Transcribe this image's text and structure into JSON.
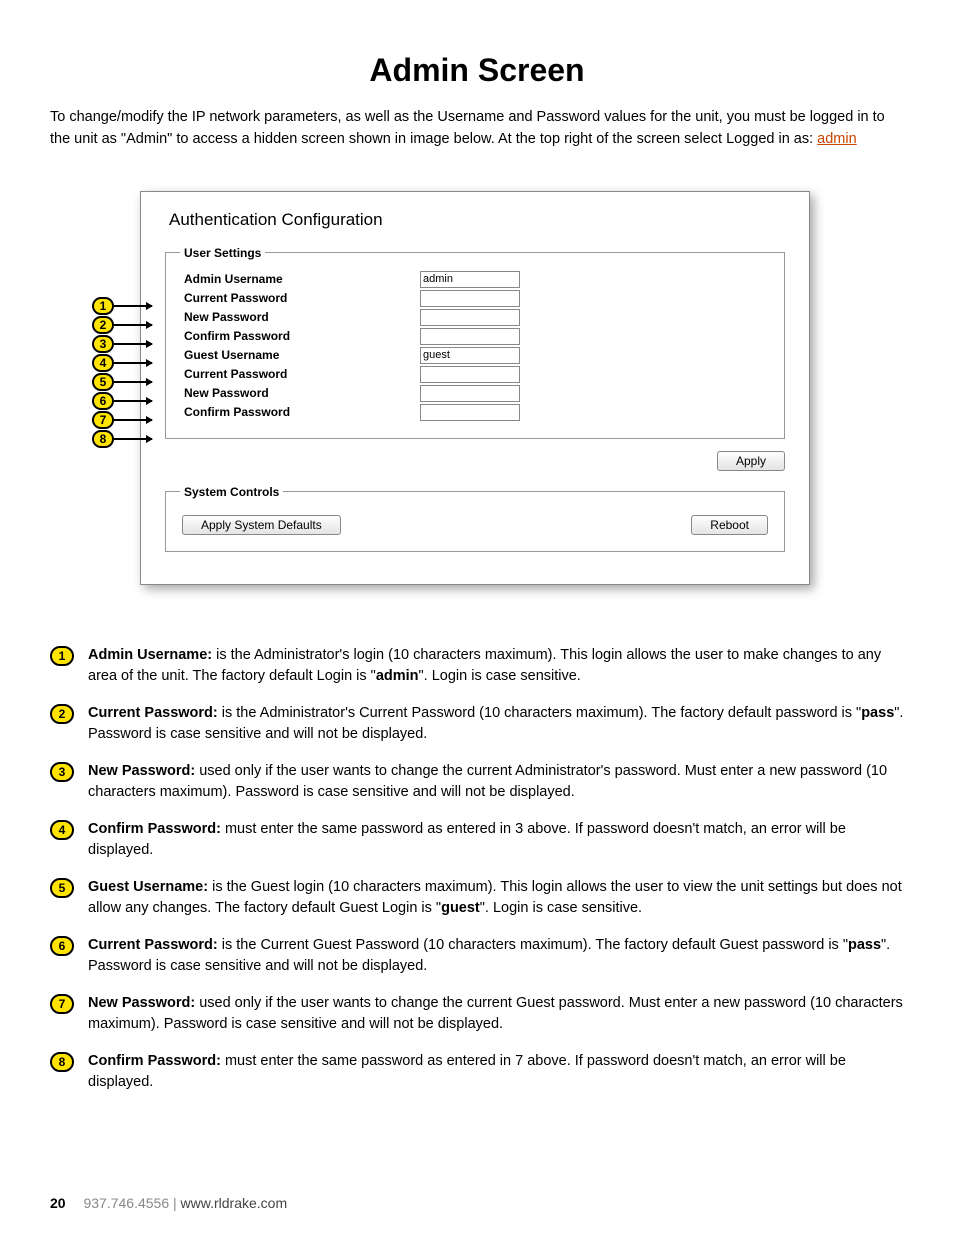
{
  "title": "Admin Screen",
  "intro_pre": "To change/modify the IP network parameters, as well as the Username and Password values for the unit, you must be logged in to the unit as \"Admin\" to access a hidden screen shown in image below. At the top right of the screen select Logged in as: ",
  "intro_link": "admin",
  "screenshot": {
    "heading": "Authentication Configuration",
    "user_settings_legend": "User Settings",
    "system_controls_legend": "System Controls",
    "rows": [
      {
        "label": "Admin Username",
        "value": "admin"
      },
      {
        "label": "Current Password",
        "value": ""
      },
      {
        "label": "New Password",
        "value": ""
      },
      {
        "label": "Confirm Password",
        "value": ""
      },
      {
        "label": "Guest Username",
        "value": "guest"
      },
      {
        "label": "Current Password",
        "value": ""
      },
      {
        "label": "New Password",
        "value": ""
      },
      {
        "label": "Confirm Password",
        "value": ""
      }
    ],
    "apply": "Apply",
    "apply_defaults": "Apply System Defaults",
    "reboot": "Reboot"
  },
  "desc": [
    {
      "n": "1",
      "term": "Admin Username:",
      "text": " is the Administrator's login (10 characters maximum). This login allows the user to make changes to any area of the unit. The factory default Login is \"",
      "bold1": "admin",
      "text2": "\". Login is case sensitive."
    },
    {
      "n": "2",
      "term": "Current Password:",
      "text": " is the Administrator's Current Password (10 characters maximum). The factory default password is \"",
      "bold1": "pass",
      "text2": "\". Password is case sensitive and will not be displayed."
    },
    {
      "n": "3",
      "term": "New Password:",
      "text": " used only if the user wants to change the current Administrator's password. Must enter a new password (10 characters maximum). Password is case sensitive and will not be displayed.",
      "bold1": "",
      "text2": ""
    },
    {
      "n": "4",
      "term": "Confirm Password:",
      "text": " must enter the same password as entered in 3 above.  If password doesn't match, an error will be displayed.",
      "bold1": "",
      "text2": ""
    },
    {
      "n": "5",
      "term": "Guest Username:",
      "text": " is the Guest login (10 characters maximum). This login allows the user to view the unit settings but does not allow any changes. The factory default Guest Login is \"",
      "bold1": "guest",
      "text2": "\". Login is case sensitive."
    },
    {
      "n": "6",
      "term": "Current Password:",
      "text": " is the Current Guest Password (10 characters maximum). The factory default Guest password is \"",
      "bold1": "pass",
      "text2": "\". Password is case sensitive and will not be displayed."
    },
    {
      "n": "7",
      "term": "New Password:",
      "text": " used only if the user wants to change the current Guest password. Must enter a new password (10 characters maximum). Password is case sensitive and will not be displayed.",
      "bold1": "",
      "text2": ""
    },
    {
      "n": "8",
      "term": "Confirm Password:",
      "text": " must enter the same password as entered in 7 above.  If password doesn't match, an error will be displayed.",
      "bold1": "",
      "text2": ""
    }
  ],
  "footer": {
    "page": "20",
    "phone": "937.746.4556 | ",
    "site": "www.rldrake.com"
  }
}
